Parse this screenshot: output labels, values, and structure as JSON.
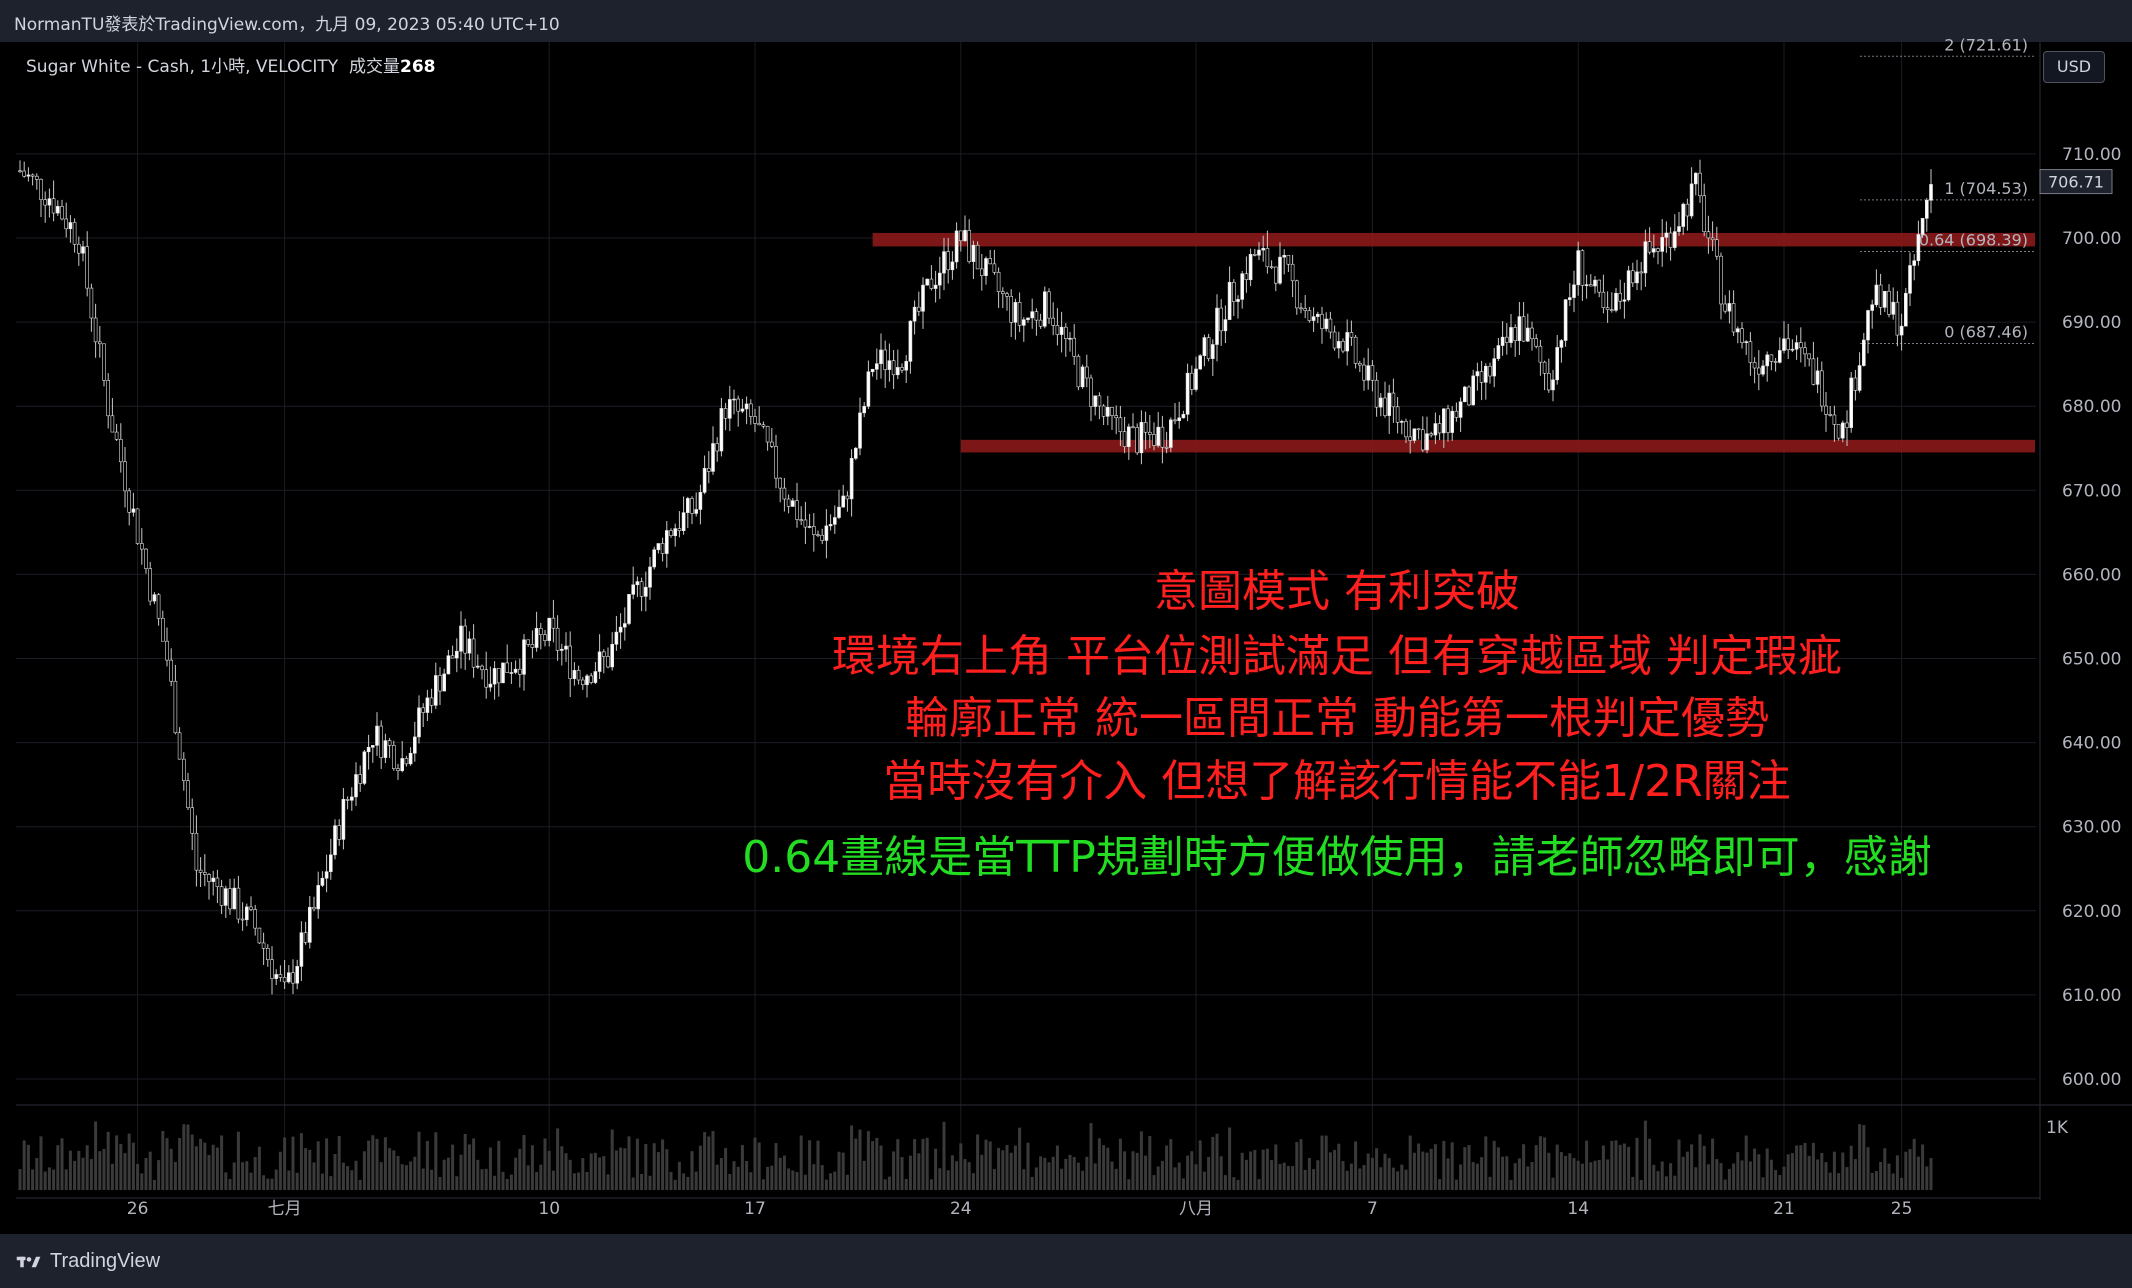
{
  "header": {
    "publisher_line": "NormanTU發表於TradingView.com，九月 09, 2023 05:40 UTC+10"
  },
  "legend": {
    "symbol": "Sugar White - Cash, 1小時, VELOCITY",
    "volume_label": "成交量",
    "volume_value": "268"
  },
  "currency_button": "USD",
  "footer": {
    "brand": "TradingView"
  },
  "colors": {
    "zone": "#8b1a1a",
    "bull": "#ffffff",
    "bear": "#ffffff",
    "volume": "#3a3a3a",
    "annotation_red": "#ff1f1f",
    "annotation_green": "#22dd22"
  },
  "annotations": {
    "line1": "意圖模式 有利突破",
    "line2": "環境右上角 平台位測試滿足 但有穿越區域 判定瑕疵",
    "line3": "輪廓正常 統一區間正常 動能第一根判定優勢",
    "line4": "當時沒有介入 但想了解該行情能不能1/2R關注",
    "line5": "0.64畫線是當TTP規劃時方便做使用，請老師忽略即可，感謝"
  },
  "chart_data": {
    "type": "candlestick",
    "title": "Sugar White - Cash, 1小時, VELOCITY",
    "ylim": [
      595,
      720
    ],
    "y_ticks": [
      "600.00",
      "610.00",
      "620.00",
      "630.00",
      "640.00",
      "650.00",
      "660.00",
      "670.00",
      "680.00",
      "690.00",
      "700.00",
      "710.00"
    ],
    "x_ticks": [
      "26",
      "七月",
      "10",
      "17",
      "24",
      "八月",
      "7",
      "14",
      "21",
      "25"
    ],
    "volume_tick": "1K",
    "last_price": "706.71",
    "fib_levels": [
      {
        "label": "2 (721.61)",
        "value": 721.61
      },
      {
        "label": "1 (704.53)",
        "value": 704.53
      },
      {
        "label": "0.64 (698.39)",
        "value": 698.39
      },
      {
        "label": "0 (687.46)",
        "value": 687.46
      }
    ],
    "zones": [
      {
        "name": "resistance",
        "low": 699.0,
        "high": 700.6,
        "x_start": "Jul 21",
        "x_end": "Aug 26"
      },
      {
        "name": "support",
        "low": 674.5,
        "high": 676.0,
        "x_start": "Jul 24",
        "x_end": "Aug 26"
      }
    ],
    "series": [
      {
        "type": "close_path",
        "points": [
          [
            "Jun 22",
            708
          ],
          [
            "Jun 23",
            705
          ],
          [
            "Jun 24",
            700
          ],
          [
            "Jun 25",
            680
          ],
          [
            "Jun 26",
            665
          ],
          [
            "Jun 27",
            650
          ],
          [
            "Jun 28",
            625
          ],
          [
            "Jun 29",
            622
          ],
          [
            "Jun 30",
            618
          ],
          [
            "Jul 1",
            610
          ],
          [
            "Jul 2",
            620
          ],
          [
            "Jul 3",
            632
          ],
          [
            "Jul 4",
            641
          ],
          [
            "Jul 5",
            638
          ],
          [
            "Jul 6",
            646
          ],
          [
            "Jul 7",
            652
          ],
          [
            "Jul 8",
            648
          ],
          [
            "Jul 9",
            650
          ],
          [
            "Jul 10",
            653
          ],
          [
            "Jul 11",
            648
          ],
          [
            "Jul 12",
            650
          ],
          [
            "Jul 13",
            658
          ],
          [
            "Jul 14",
            665
          ],
          [
            "Jul 15",
            668
          ],
          [
            "Jul 16",
            680
          ],
          [
            "Jul 17",
            678
          ],
          [
            "Jul 18",
            670
          ],
          [
            "Jul 19",
            664
          ],
          [
            "Jul 20",
            668
          ],
          [
            "Jul 21",
            685
          ],
          [
            "Jul 22",
            686
          ],
          [
            "Jul 23",
            695
          ],
          [
            "Jul 24",
            700
          ],
          [
            "Jul 25",
            695
          ],
          [
            "Jul 26",
            690
          ],
          [
            "Jul 27",
            692
          ],
          [
            "Jul 28",
            684
          ],
          [
            "Jul 29",
            678
          ],
          [
            "Jul 30",
            676
          ],
          [
            "Jul 31",
            677
          ],
          [
            "Aug 1",
            684
          ],
          [
            "Aug 2",
            692
          ],
          [
            "Aug 3",
            698
          ],
          [
            "Aug 4",
            696
          ],
          [
            "Aug 5",
            690
          ],
          [
            "Aug 6",
            688
          ],
          [
            "Aug 7",
            682
          ],
          [
            "Aug 8",
            678
          ],
          [
            "Aug 9",
            676
          ],
          [
            "Aug 10",
            680
          ],
          [
            "Aug 11",
            684
          ],
          [
            "Aug 12",
            690
          ],
          [
            "Aug 13",
            683
          ],
          [
            "Aug 14",
            697
          ],
          [
            "Aug 15",
            690
          ],
          [
            "Aug 16",
            697
          ],
          [
            "Aug 17",
            700
          ],
          [
            "Aug 18",
            706
          ],
          [
            "Aug 19",
            692
          ],
          [
            "Aug 20",
            685
          ],
          [
            "Aug 21",
            688
          ],
          [
            "Aug 22",
            684
          ],
          [
            "Aug 23",
            677
          ],
          [
            "Aug 24",
            693
          ],
          [
            "Aug 25",
            690
          ],
          [
            "Aug 26",
            706.71
          ]
        ]
      }
    ]
  }
}
